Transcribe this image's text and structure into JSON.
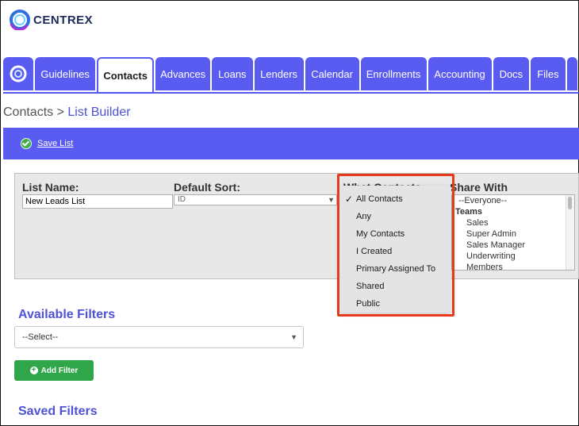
{
  "brand": {
    "name": "CENTREX"
  },
  "nav": {
    "tabs": [
      "Guidelines",
      "Contacts",
      "Advances",
      "Loans",
      "Lenders",
      "Calendar",
      "Enrollments",
      "Accounting",
      "Docs",
      "Files"
    ],
    "active": "Contacts"
  },
  "breadcrumb": {
    "parent": "Contacts",
    "sep": ">",
    "current": "List Builder"
  },
  "toolbar": {
    "save_label": "Save List"
  },
  "form": {
    "list_name_label": "List Name:",
    "list_name_value": "New Leads List",
    "default_sort_label": "Default Sort:",
    "default_sort_value": "ID",
    "what_contacts_label": "What Contacts",
    "share_with_label": "Share With",
    "share_options": [
      {
        "text": "--Everyone--",
        "kind": "opt"
      },
      {
        "text": "Teams",
        "kind": "grp"
      },
      {
        "text": "Sales",
        "kind": "sub"
      },
      {
        "text": "Super Admin",
        "kind": "sub"
      },
      {
        "text": "Sales Manager",
        "kind": "sub"
      },
      {
        "text": "Underwriting",
        "kind": "sub"
      },
      {
        "text": "Members",
        "kind": "sub"
      }
    ]
  },
  "what_contacts_dropdown": {
    "selected": "All Contacts",
    "options": [
      "All Contacts",
      "Any",
      "My Contacts",
      "I Created",
      "Primary Assigned To",
      "Shared",
      "Public"
    ]
  },
  "available_filters": {
    "heading": "Available Filters",
    "select_value": "--Select--",
    "add_label": "Add Filter"
  },
  "saved_filters": {
    "heading": "Saved Filters"
  },
  "colors": {
    "accent": "#5a5cf1",
    "success": "#2fa64a",
    "highlight": "#e8391c"
  }
}
